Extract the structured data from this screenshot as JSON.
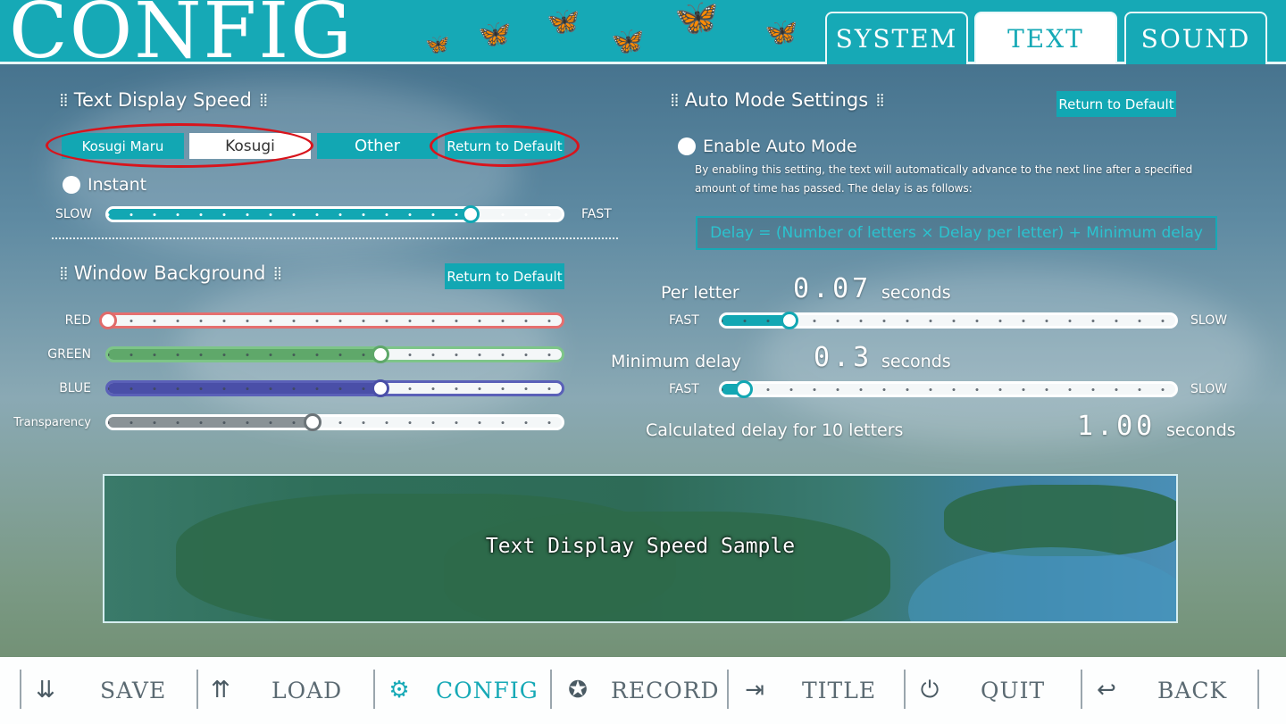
{
  "header": {
    "title": "CONFIG",
    "tabs": [
      {
        "label": "SYSTEM",
        "active": false
      },
      {
        "label": "TEXT",
        "active": true
      },
      {
        "label": "SOUND",
        "active": false
      }
    ]
  },
  "text_speed": {
    "heading": "Text Display Speed",
    "font_buttons": [
      "Kosugi Maru",
      "Kosugi",
      "Other"
    ],
    "return_default": "Return to Default",
    "instant_label": "Instant",
    "slow_label": "SLOW",
    "fast_label": "FAST",
    "speed_level": 0.8
  },
  "window_bg": {
    "heading": "Window Background",
    "return_default": "Return to Default",
    "sliders": [
      {
        "label": "RED",
        "value": 0.0,
        "color": "#e06a6a"
      },
      {
        "label": "GREEN",
        "value": 0.6,
        "color": "#5fa86a"
      },
      {
        "label": "BLUE",
        "value": 0.6,
        "color": "#4a4fa8"
      },
      {
        "label": "Transparency",
        "value": 0.45,
        "color": "#8a9296"
      }
    ]
  },
  "auto_mode": {
    "heading": "Auto Mode Settings",
    "return_default": "Return to Default",
    "enable_label": "Enable Auto Mode",
    "description": "By enabling this setting, the text will automatically advance to the next line after a specified amount of time has passed. The delay is as follows:",
    "formula": "Delay = (Number of letters × Delay per letter) + Minimum delay",
    "per_letter_label": "Per letter",
    "per_letter_value": "0.07",
    "per_letter_unit": "seconds",
    "per_letter_level": 0.15,
    "min_delay_label": "Minimum delay",
    "min_delay_value": "0.3",
    "min_delay_unit": "seconds",
    "min_delay_level": 0.05,
    "fast_label": "FAST",
    "slow_label": "SLOW",
    "calc_label": "Calculated delay for 10 letters",
    "calc_value": "1.00",
    "calc_unit": "seconds"
  },
  "sample": {
    "text": "Text Display Speed Sample"
  },
  "nav": [
    {
      "label": "SAVE",
      "icon": "save-icon",
      "active": false
    },
    {
      "label": "LOAD",
      "icon": "load-icon",
      "active": false
    },
    {
      "label": "CONFIG",
      "icon": "gear-icon",
      "active": true
    },
    {
      "label": "RECORD",
      "icon": "medal-icon",
      "active": false
    },
    {
      "label": "TITLE",
      "icon": "exit-icon",
      "active": false
    },
    {
      "label": "QUIT",
      "icon": "power-icon",
      "active": false
    },
    {
      "label": "BACK",
      "icon": "back-arrow-icon",
      "active": false
    }
  ],
  "colors": {
    "accent": "#16a9b6",
    "highlight_ring": "#d8141c"
  }
}
